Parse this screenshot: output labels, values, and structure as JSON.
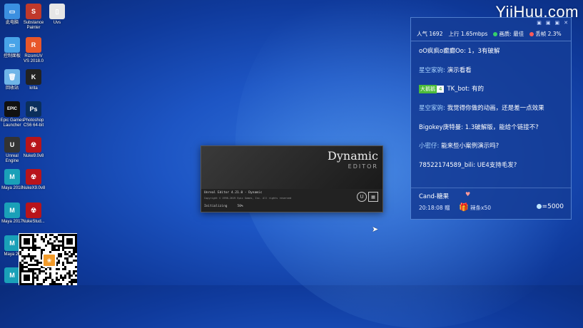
{
  "watermark": "YiiHuu.com",
  "desktop_icons": [
    {
      "label": "此电脑",
      "glyph": "▭",
      "color": "#3b8fe0"
    },
    {
      "label": "Substance Painter",
      "glyph": "S",
      "color": "#c0392b"
    },
    {
      "label": "Uvs",
      "glyph": "▯",
      "color": "#e6e6e6"
    },
    {
      "label": "控制面板",
      "glyph": "▭",
      "color": "#48a3e8"
    },
    {
      "label": "RizomUV VS 2018.0",
      "glyph": "R",
      "color": "#e8562a"
    },
    {
      "label": "回收站",
      "glyph": "🗑",
      "color": "#6fb5e8"
    },
    {
      "label": "krita",
      "glyph": "K",
      "color": "#222"
    },
    {
      "label": "Epic Games Launcher",
      "glyph": "EPIC",
      "color": "#111"
    },
    {
      "label": "Photoshop CS6 64-bit",
      "glyph": "Ps",
      "color": "#0b2f5c"
    },
    {
      "label": "Unreal Engine",
      "glyph": "U",
      "color": "#333"
    },
    {
      "label": "Nuke9.0v8",
      "glyph": "☢",
      "color": "#b8141b"
    },
    {
      "label": "Maya 2018",
      "glyph": "M",
      "color": "#1aa0b8"
    },
    {
      "label": "NukeX9.0v8",
      "glyph": "☢",
      "color": "#b8141b"
    },
    {
      "label": "Maya 2017",
      "glyph": "M",
      "color": "#1aa0b8"
    },
    {
      "label": "NukeStud...",
      "glyph": "☢",
      "color": "#b8141b"
    },
    {
      "label": "Maya 20",
      "glyph": "M",
      "color": "#1aa0b8"
    },
    {
      "label": "",
      "glyph": "M",
      "color": "#1aa0b8"
    }
  ],
  "splash": {
    "title": "Dynamic",
    "subtitle": "EDITOR",
    "version": "Unreal Editor 4.21.0  -  Dynamic",
    "copyright": "Copyright © 1998-2019   Epic Games, Inc.   All rights reserved",
    "status": "Initializing",
    "percent": "50%",
    "logo1": "U",
    "logo2": "▦"
  },
  "chat": {
    "controls": [
      "▣",
      "▣",
      "▣",
      "✕"
    ],
    "popularity": "人气 1692",
    "upload": "上行 1.65mbps",
    "quality": "画质: 最佳",
    "drop": "丢帧 2.3%",
    "quality_color": "#35d06a",
    "drop_color": "#ff5a5a",
    "messages": [
      {
        "user": "",
        "text": "oO疯疯o癫癫Oo: 1，3有破解"
      },
      {
        "user": "星空家驹: ",
        "text": "演示看看"
      },
      {
        "badge": "大鹅鹅",
        "level": "4",
        "user": "",
        "text": "TK_bot: 有的"
      },
      {
        "user": "星空家驹: ",
        "text": "我觉得你做的动画，还是差一点效果"
      },
      {
        "user": "",
        "text": "Bigokey庚特曼: 1.3破解版，能给个链接不?"
      },
      {
        "user": "小密仔: ",
        "text": "能来些小案例演示吗?"
      },
      {
        "user": "",
        "text": "78522174589_bili: UE4支持毛发?"
      }
    ],
    "gift": {
      "user": "Cand-糖果",
      "time": "20:18:08 赠",
      "item": "辣条x50",
      "score": "=5000",
      "mark": "♥"
    }
  }
}
